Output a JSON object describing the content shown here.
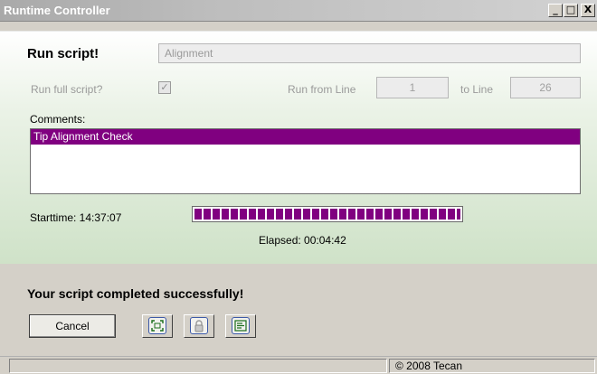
{
  "window": {
    "title": "Runtime Controller",
    "minimize": "_",
    "maximize": "□",
    "close": "X"
  },
  "form": {
    "run_script_label": "Run script!",
    "script_name": "Alignment",
    "run_full_label": "Run full script?",
    "run_full_checked": true,
    "checkbox_mark": "✓",
    "run_from_label": "Run from Line",
    "from_line": "1",
    "to_line_label": "to Line",
    "to_line": "26",
    "comments_label": "Comments:",
    "comments": [
      "Tip Alignment Check"
    ]
  },
  "progress": {
    "start_time": "Starttime: 14:37:07",
    "elapsed": "Elapsed: 00:04:42",
    "fraction": 1.0,
    "color": "#800080"
  },
  "result": {
    "message": "Your script completed successfully!",
    "cancel_label": "Cancel",
    "icon_buttons": [
      "fullscreen-icon",
      "lock-icon",
      "log-icon"
    ]
  },
  "statusbar": {
    "left": "",
    "right": "© 2008 Tecan"
  }
}
